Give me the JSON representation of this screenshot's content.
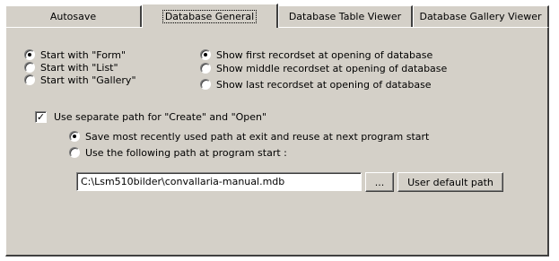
{
  "tabs": [
    {
      "label": "Autosave",
      "active": false
    },
    {
      "label": "Database General",
      "active": true
    },
    {
      "label": "Database Table Viewer",
      "active": false
    },
    {
      "label": "Database Gallery Viewer",
      "active": false
    }
  ],
  "start_view": {
    "options": [
      {
        "label": "Start with \"Form\"",
        "selected": true
      },
      {
        "label": "Start with \"List\"",
        "selected": false
      },
      {
        "label": "Start with \"Gallery\"",
        "selected": false
      }
    ]
  },
  "recordset": {
    "options": [
      {
        "label": "Show first recordset at opening of database",
        "selected": true
      },
      {
        "label": "Show middle recordset at opening of database",
        "selected": false
      },
      {
        "label": "Show last recordset at opening of database",
        "selected": false
      }
    ]
  },
  "separate_path": {
    "label": "Use separate path for \"Create\" and \"Open\"",
    "checked": true,
    "options": [
      {
        "label": "Save most recently used path at exit and reuse at next program start",
        "selected": true
      },
      {
        "label": "Use the following path at program start :",
        "selected": false
      }
    ],
    "path_value": "C:\\Lsm510bilder\\convallaria-manual.mdb",
    "browse_label": "...",
    "default_label": "User default path"
  }
}
